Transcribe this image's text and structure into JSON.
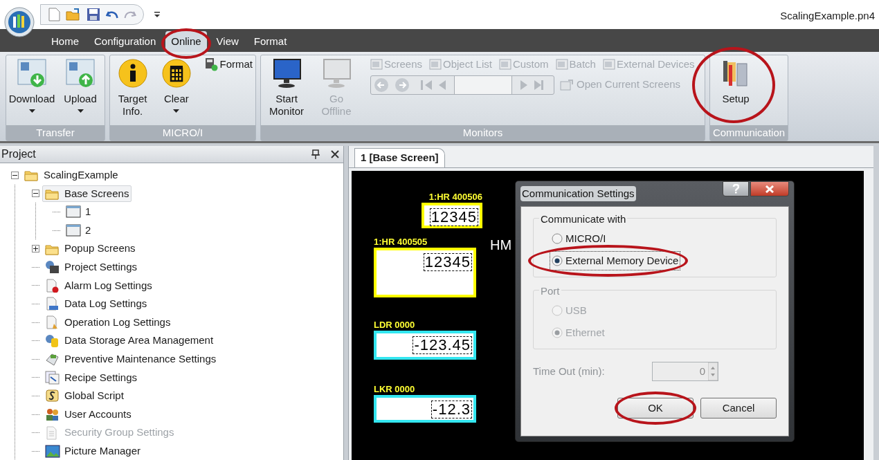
{
  "title_bar": {
    "file_name": "ScalingExample.pn4"
  },
  "menu_tabs": [
    {
      "label": "Home",
      "selected": false,
      "circled": false
    },
    {
      "label": "Configuration",
      "selected": false,
      "circled": false
    },
    {
      "label": "Online",
      "selected": true,
      "circled": true
    },
    {
      "label": "View",
      "selected": false,
      "circled": false
    },
    {
      "label": "Format",
      "selected": false,
      "circled": false
    }
  ],
  "ribbon": {
    "groups": [
      {
        "title": "Transfer",
        "items": [
          {
            "kind": "download",
            "label": "Download",
            "dropdown": true,
            "disabled": false,
            "circled": false
          },
          {
            "kind": "upload",
            "label": "Upload",
            "dropdown": true,
            "disabled": false,
            "circled": false
          }
        ]
      },
      {
        "title": "MICRO/I",
        "items": [
          {
            "kind": "info",
            "label": "Target Info.",
            "dropdown": false,
            "disabled": false,
            "circled": false
          },
          {
            "kind": "clear",
            "label": "Clear",
            "dropdown": true,
            "disabled": false,
            "circled": false
          },
          {
            "kind": "format",
            "label": "Format",
            "disabled": false
          }
        ]
      },
      {
        "title": "Monitors",
        "items": [
          {
            "kind": "monitor",
            "label": "Start Monitor",
            "dropdown": false,
            "disabled": false,
            "circled": false
          },
          {
            "kind": "offline",
            "label": "Go Offline",
            "dropdown": false,
            "disabled": true,
            "circled": false
          }
        ],
        "small_items": [
          {
            "label": "Screens",
            "disabled": true
          },
          {
            "label": "Object List",
            "disabled": true
          },
          {
            "label": "Custom",
            "disabled": true
          },
          {
            "label": "Batch",
            "disabled": true
          },
          {
            "label": "External Devices",
            "disabled": true
          }
        ],
        "open_current": {
          "label": "Open Current Screens",
          "disabled": true
        }
      },
      {
        "title": "Communication",
        "items": [
          {
            "kind": "setup",
            "label": "Setup",
            "dropdown": false,
            "disabled": false,
            "circled": true
          }
        ]
      }
    ]
  },
  "project_panel": {
    "title": "Project",
    "tree": [
      {
        "kind": "folder",
        "label": "ScalingExample",
        "expanded": true,
        "selected": false,
        "disabled": false,
        "children": [
          {
            "kind": "folder",
            "label": "Base Screens",
            "expanded": true,
            "selected": true,
            "disabled": false,
            "children": [
              {
                "kind": "screen",
                "label": "1",
                "selected": false,
                "disabled": false
              },
              {
                "kind": "screen",
                "label": "2",
                "selected": false,
                "disabled": false
              }
            ]
          },
          {
            "kind": "folder",
            "label": "Popup Screens",
            "expanded": false,
            "selected": false,
            "disabled": false
          },
          {
            "kind": "gear",
            "label": "Project Settings",
            "selected": false,
            "disabled": false
          },
          {
            "kind": "alarm",
            "label": "Alarm Log Settings",
            "selected": false,
            "disabled": false
          },
          {
            "kind": "datalog",
            "label": "Data Log Settings",
            "selected": false,
            "disabled": false
          },
          {
            "kind": "oplog",
            "label": "Operation Log Settings",
            "selected": false,
            "disabled": false
          },
          {
            "kind": "storage",
            "label": "Data Storage Area Management",
            "selected": false,
            "disabled": false
          },
          {
            "kind": "maintenance",
            "label": "Preventive Maintenance Settings",
            "selected": false,
            "disabled": false
          },
          {
            "kind": "recipe",
            "label": "Recipe Settings",
            "selected": false,
            "disabled": false
          },
          {
            "kind": "script",
            "label": "Global Script",
            "selected": false,
            "disabled": false
          },
          {
            "kind": "users",
            "label": "User Accounts",
            "selected": false,
            "disabled": false
          },
          {
            "kind": "security",
            "label": "Security Group Settings",
            "selected": false,
            "disabled": true
          },
          {
            "kind": "picture",
            "label": "Picture Manager",
            "selected": false,
            "disabled": false
          }
        ]
      }
    ]
  },
  "editor": {
    "tab": "1 [Base Screen]",
    "objects": [
      {
        "label": "1:HR 400506",
        "value": "12345",
        "color": "#ffff00"
      },
      {
        "label": "1:HR 400505",
        "value": "12345",
        "color": "#ffff00"
      },
      {
        "label": "LDR 0000",
        "value": "-123.45",
        "color": "#33e6f0"
      },
      {
        "label": "LKR 0000",
        "value": "-12.3",
        "color": "#33e6f0"
      }
    ],
    "text_fragment": "HM"
  },
  "dialog": {
    "title": "Communication Settings",
    "communicate_with": {
      "label": "Communicate with",
      "options": [
        {
          "label": "MICRO/I",
          "selected": false,
          "disabled": false,
          "circled": false
        },
        {
          "label": "External Memory Device",
          "selected": true,
          "disabled": false,
          "circled": true
        }
      ]
    },
    "port": {
      "label": "Port",
      "options": [
        {
          "label": "USB",
          "selected": false,
          "disabled": true,
          "circled": false
        },
        {
          "label": "Ethernet",
          "selected": true,
          "disabled": true,
          "circled": false
        }
      ]
    },
    "timeout": {
      "label": "Time Out (min):",
      "value": "0",
      "disabled": true
    },
    "buttons": [
      {
        "label": "OK",
        "circled": true
      },
      {
        "label": "Cancel",
        "circled": false
      }
    ]
  }
}
